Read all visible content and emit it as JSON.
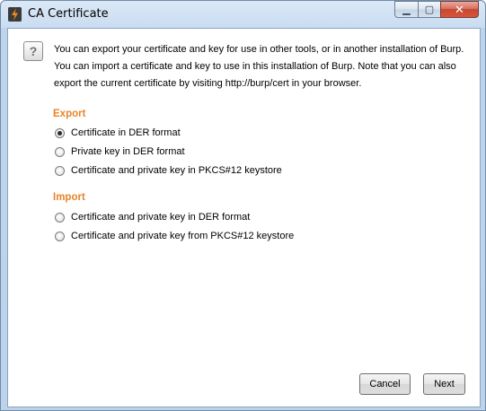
{
  "window": {
    "title": "CA Certificate",
    "controls": {
      "minimize": "▁",
      "maximize": "▢",
      "close": "✕"
    }
  },
  "info": {
    "icon": "help-question-icon",
    "icon_glyph": "?",
    "lines": [
      "You can export your certificate and key for use in other tools, or in another installation of Burp.",
      "You can import a certificate and key to use in this installation of Burp. Note that you can also",
      "export the current certificate by visiting http://burp/cert in your browser."
    ]
  },
  "export": {
    "heading": "Export",
    "options": [
      {
        "label": "Certificate in DER format",
        "selected": true
      },
      {
        "label": "Private key in DER format",
        "selected": false
      },
      {
        "label": "Certificate and private key in PKCS#12 keystore",
        "selected": false
      }
    ]
  },
  "import": {
    "heading": "Import",
    "options": [
      {
        "label": "Certificate and private key in DER format",
        "selected": false
      },
      {
        "label": "Certificate and private key from PKCS#12 keystore",
        "selected": false
      }
    ]
  },
  "buttons": {
    "cancel": "Cancel",
    "next": "Next"
  },
  "colors": {
    "section_heading": "#e8842a",
    "titlebar": "#c9dcf1",
    "close_button": "#c84730"
  }
}
